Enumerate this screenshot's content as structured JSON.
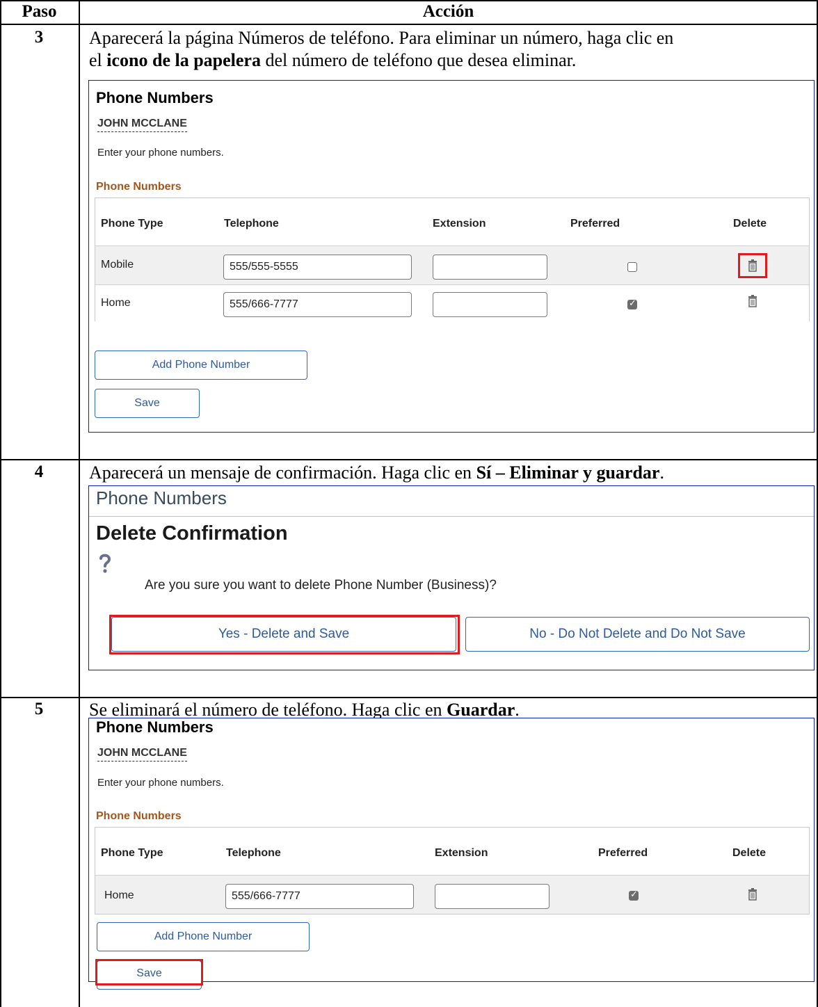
{
  "table": {
    "col_step": "Paso",
    "col_action": "Acción"
  },
  "steps": [
    {
      "number": "3",
      "text": [
        {
          "t": "Aparecerá la página Números de teléfono. Para eliminar un número, haga clic en",
          "b": false
        },
        {
          "t": "el ",
          "b": false,
          "newline": true
        },
        {
          "t": "icono de la papelera",
          "b": true
        },
        {
          "t": " del número de teléfono que desea eliminar.",
          "b": false
        }
      ],
      "panel": {
        "title": "Phone Numbers",
        "person": "JOHN MCCLANE",
        "description": "Enter your phone numbers.",
        "section": "Phone Numbers",
        "columns": [
          "Phone Type",
          "Telephone",
          "Extension",
          "Preferred",
          "Delete"
        ],
        "rows": [
          {
            "type": "Mobile",
            "telephone": "555/555-5555",
            "extension": "",
            "preferred": false,
            "highlight_delete": true
          },
          {
            "type": "Home",
            "telephone": "555/666-7777",
            "extension": "",
            "preferred": true,
            "highlight_delete": false
          }
        ],
        "add_button": "Add Phone Number",
        "save_button": "Save"
      }
    },
    {
      "number": "4",
      "text": [
        {
          "t": "Aparecerá un mensaje de confirmación. Haga clic en ",
          "b": false
        },
        {
          "t": "Sí – Eliminar y guardar",
          "b": true
        },
        {
          "t": ".",
          "b": false
        }
      ],
      "dialog": {
        "header": "Phone Numbers",
        "title": "Delete Confirmation",
        "icon": "question-icon",
        "message": "Are you sure you want to delete Phone Number (Business)?",
        "yes_button": "Yes - Delete and Save",
        "no_button": "No - Do Not Delete and Do Not Save"
      }
    },
    {
      "number": "5",
      "text": [
        {
          "t": "Se eliminará el número de teléfono. Haga clic en ",
          "b": false
        },
        {
          "t": "Guardar",
          "b": true
        },
        {
          "t": ".",
          "b": false
        }
      ],
      "panel": {
        "title": "Phone Numbers",
        "person": "JOHN MCCLANE",
        "description": "Enter your phone numbers.",
        "section": "Phone Numbers",
        "columns": [
          "Phone Type",
          "Telephone",
          "Extension",
          "Preferred",
          "Delete"
        ],
        "rows": [
          {
            "type": "Home",
            "telephone": "555/666-7777",
            "extension": "",
            "preferred": true,
            "highlight_delete": false
          }
        ],
        "add_button": "Add Phone Number",
        "save_button": "Save"
      }
    }
  ],
  "colors": {
    "frame": "#0a1fb5",
    "highlight": "#e01b1b",
    "section_label": "#a4561d",
    "button_text": "#2b5aa3"
  }
}
